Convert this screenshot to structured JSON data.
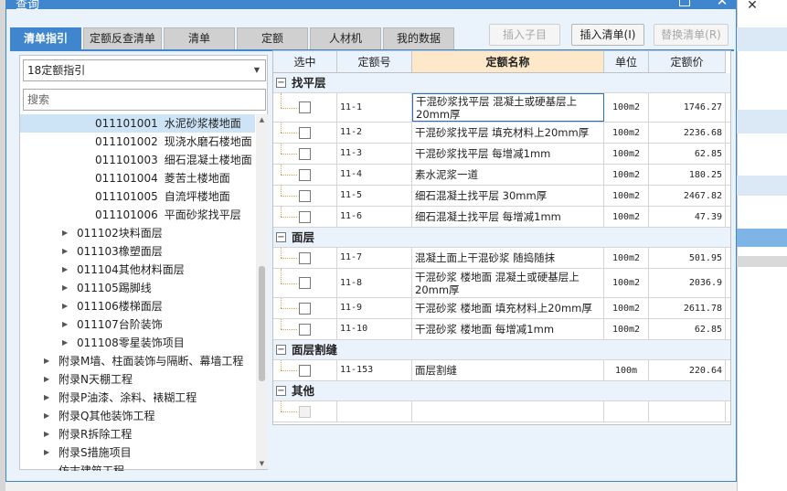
{
  "window": {
    "title": "查询",
    "close_glyph": "✕",
    "bg_close_glyph": "✕"
  },
  "tabs": [
    {
      "label": "清单指引",
      "active": true
    },
    {
      "label": "定额反查清单"
    },
    {
      "label": "清单"
    },
    {
      "label": "定额"
    },
    {
      "label": "人材机"
    },
    {
      "label": "我的数据"
    }
  ],
  "actions": {
    "insert_child": "插入子目",
    "insert_list": "插入清单(I)",
    "replace_list": "替换清单(R)"
  },
  "left": {
    "dropdown_value": "18定额指引",
    "search_placeholder": "搜索",
    "tree": [
      {
        "code": "011101001",
        "name": "水泥砂浆楼地面",
        "selected": true
      },
      {
        "code": "011101002",
        "name": "现浇水磨石楼地面"
      },
      {
        "code": "011101003",
        "name": "细石混凝土楼地面"
      },
      {
        "code": "011101004",
        "name": "菱苦土楼地面"
      },
      {
        "code": "011101005",
        "name": "自流坪楼地面"
      },
      {
        "code": "011101006",
        "name": "平面砂浆找平层"
      },
      {
        "label": "011102块料面层"
      },
      {
        "label": "011103橡塑面层"
      },
      {
        "label": "011104其他材料面层"
      },
      {
        "label": "011105踢脚线"
      },
      {
        "label": "011106楼梯面层"
      },
      {
        "label": "011107台阶装饰"
      },
      {
        "label": "011108零星装饰项目"
      },
      {
        "label": "附录M墙、柱面装饰与隔断、幕墙工程"
      },
      {
        "label": "附录N天棚工程"
      },
      {
        "label": "附录P油漆、涂料、裱糊工程"
      },
      {
        "label": "附录Q其他装饰工程"
      },
      {
        "label": "附录R拆除工程"
      },
      {
        "label": "附录S措施项目"
      },
      {
        "label": "仿古建筑工程"
      }
    ]
  },
  "grid": {
    "headers": {
      "select": "选中",
      "code": "定额号",
      "name": "定额名称",
      "unit": "单位",
      "price": "定额价"
    },
    "groups": [
      {
        "title": "找平层",
        "rows": [
          {
            "code": "11-1",
            "name": "干混砂浆找平层 混凝土或硬基层上 20mm厚",
            "unit": "100m2",
            "price": "1746.27"
          },
          {
            "code": "11-2",
            "name": "干混砂浆找平层 填充材料上20mm厚",
            "unit": "100m2",
            "price": "2236.68"
          },
          {
            "code": "11-3",
            "name": "干混砂浆找平层 每增减1mm",
            "unit": "100m2",
            "price": "62.85"
          },
          {
            "code": "11-4",
            "name": "素水泥浆一道",
            "unit": "100m2",
            "price": "180.25"
          },
          {
            "code": "11-5",
            "name": "细石混凝土找平层 30mm厚",
            "unit": "100m2",
            "price": "2467.82"
          },
          {
            "code": "11-6",
            "name": "细石混凝土找平层 每增减1mm",
            "unit": "100m2",
            "price": "47.39"
          }
        ]
      },
      {
        "title": "面层",
        "rows": [
          {
            "code": "11-7",
            "name": "混凝土面上干混砂浆 随捣随抹",
            "unit": "100m2",
            "price": "501.95"
          },
          {
            "code": "11-8",
            "name": "干混砂浆 楼地面 混凝土或硬基层上 20mm厚",
            "unit": "100m2",
            "price": "2036.9"
          },
          {
            "code": "11-9",
            "name": "干混砂浆 楼地面 填充材料上20mm厚",
            "unit": "100m2",
            "price": "2611.78"
          },
          {
            "code": "11-10",
            "name": "干混砂浆 楼地面 每增减1mm",
            "unit": "100m2",
            "price": "62.85"
          }
        ]
      },
      {
        "title": "面层割缝",
        "rows": [
          {
            "code": "11-153",
            "name": "面层割缝",
            "unit": "100m",
            "price": "220.64"
          }
        ]
      },
      {
        "title": "其他",
        "rows": [
          {
            "code": "",
            "name": "",
            "unit": "",
            "price": ""
          }
        ]
      }
    ]
  },
  "colors": {
    "accent": "#3f86cf",
    "header_highlight": "#fde9c9",
    "selection": "#cde4f7"
  },
  "icons": {
    "collapse": "−",
    "caret": "▼",
    "expand": "▶",
    "scroll_up": "▲",
    "scroll_down": "▼"
  }
}
